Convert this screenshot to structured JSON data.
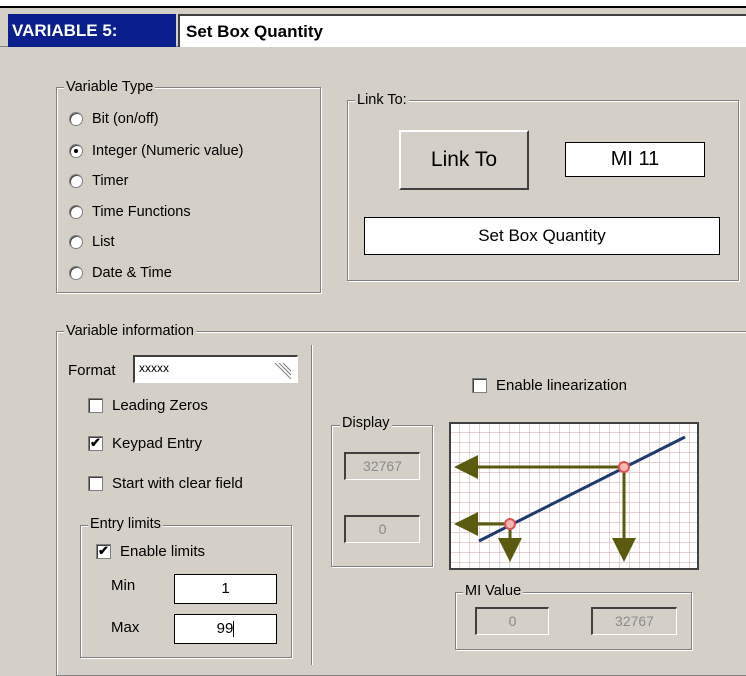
{
  "header": {
    "variable_label": "VARIABLE 5:",
    "variable_name": "Set Box Quantity"
  },
  "variable_type": {
    "title": "Variable Type",
    "options": [
      {
        "label": "Bit (on/off)",
        "selected": false
      },
      {
        "label": "Integer (Numeric value)",
        "selected": true
      },
      {
        "label": "Timer",
        "selected": false
      },
      {
        "label": "Time Functions",
        "selected": false
      },
      {
        "label": "List",
        "selected": false
      },
      {
        "label": "Date & Time",
        "selected": false
      }
    ]
  },
  "link_to": {
    "title": "Link To:",
    "button_label": "Link To",
    "operand": "MI  11",
    "description": "Set Box Quantity"
  },
  "variable_info": {
    "title": "Variable information",
    "format_label": "Format",
    "format_value": "xxxxx",
    "leading_zeros": {
      "label": "Leading Zeros",
      "checked": false
    },
    "keypad_entry": {
      "label": "Keypad Entry",
      "checked": true
    },
    "start_clear": {
      "label": "Start with clear field",
      "checked": false
    },
    "entry_limits": {
      "title": "Entry limits",
      "enable": {
        "label": "Enable limits",
        "checked": true
      },
      "min_label": "Min",
      "min_value": "1",
      "max_label": "Max",
      "max_value": "99"
    }
  },
  "linearization": {
    "enable": {
      "label": "Enable linearization",
      "checked": false
    },
    "display_title": "Display",
    "display_high": "32767",
    "display_low": "0",
    "mi_title": "MI Value",
    "mi_low": "0",
    "mi_high": "32767"
  },
  "colors": {
    "title_bg": "#0a1e8c",
    "graph_grid": "#c8a7a7",
    "graph_line": "#1f3a6e",
    "graph_arrow": "#5a5a10",
    "point": "#d9534f"
  }
}
